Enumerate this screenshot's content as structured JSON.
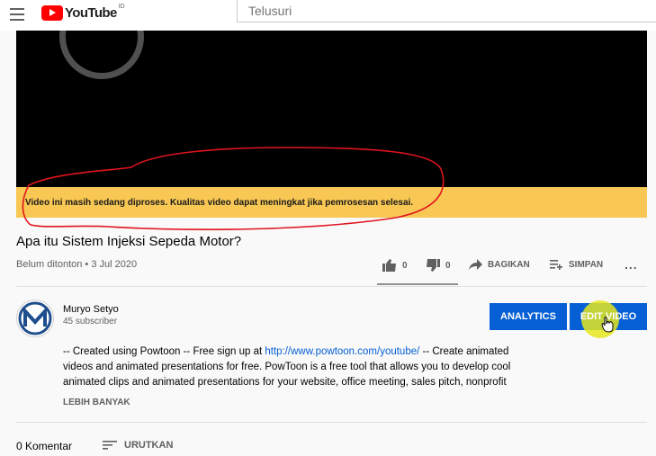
{
  "header": {
    "logo_text": "YouTube",
    "country_code": "ID",
    "search_placeholder": "Telusuri"
  },
  "player": {
    "processing_message": "Video ini masih sedang diproses. Kualitas video dapat meningkat jika pemrosesan selesai."
  },
  "video": {
    "title": "Apa itu Sistem Injeksi Sepeda Motor?",
    "meta": "Belum ditonton • 3 Jul 2020",
    "likes": "0",
    "dislikes": "0",
    "share_label": "BAGIKAN",
    "save_label": "SIMPAN",
    "more_label": "..."
  },
  "channel": {
    "name": "Muryo Setyo",
    "subscribers": "45 subscriber"
  },
  "buttons": {
    "analytics": "ANALYTICS",
    "edit_video": "EDIT VIDEO"
  },
  "description": {
    "part1": "-- Created using Powtoon -- Free sign up at ",
    "link": "http://www.powtoon.com/youtube/",
    "part2": " -- Create animated videos and animated presentations for free.  PowToon is a free tool that allows you to develop cool animated clips and animated presentations for your website, office meeting, sales pitch, nonprofit",
    "show_more": "LEBIH BANYAK"
  },
  "comments": {
    "count_label": "0 Komentar",
    "sort_label": "URUTKAN"
  },
  "colors": {
    "accent": "#065fd4",
    "banner": "#f8c754",
    "logo_red": "#ff0000",
    "annotation": "#e0141e"
  }
}
